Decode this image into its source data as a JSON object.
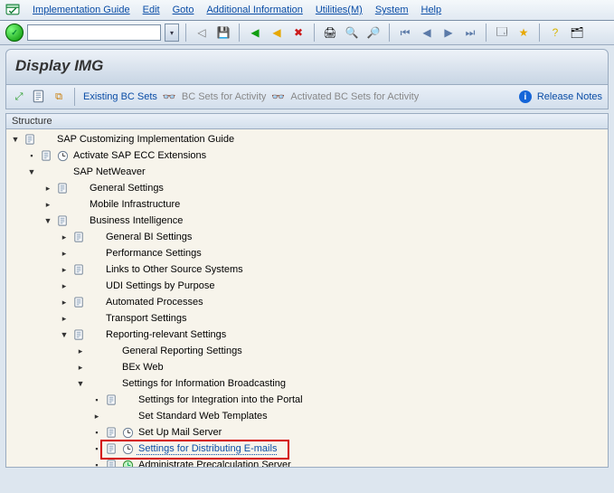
{
  "menu": {
    "items": [
      {
        "label": "Implementation Guide",
        "underline": 0
      },
      {
        "label": "Edit",
        "underline": 0
      },
      {
        "label": "Goto",
        "underline": 0
      },
      {
        "label": "Additional Information",
        "underline": 0
      },
      {
        "label": "Utilities(M)",
        "underline": 10
      },
      {
        "label": "System",
        "underline": 0
      },
      {
        "label": "Help",
        "underline": 0
      }
    ]
  },
  "cmdbar": {
    "value": "",
    "placeholder": ""
  },
  "title": "Display IMG",
  "apptb": {
    "existing": "Existing BC Sets",
    "bc_activity": "BC Sets for Activity",
    "bc_activated": "Activated BC Sets for Activity",
    "release_notes": "Release Notes"
  },
  "structure_header": "Structure",
  "tree_labels": {
    "root": "SAP Customizing Implementation Guide",
    "l1a": "Activate SAP ECC Extensions",
    "l1b": "SAP NetWeaver",
    "l2a": "General Settings",
    "l2b": "Mobile Infrastructure",
    "l2c": "Business Intelligence",
    "l3a": "General BI Settings",
    "l3b": "Performance Settings",
    "l3c": "Links to Other Source Systems",
    "l3d": "UDI Settings by Purpose",
    "l3e": "Automated Processes",
    "l3f": "Transport Settings",
    "l3g": "Reporting-relevant Settings",
    "l4a": "General Reporting Settings",
    "l4b": "BEx Web",
    "l4c": "Settings for Information Broadcasting",
    "l5a": "Settings for Integration into the Portal",
    "l5b": "Set Standard Web Templates",
    "l5c": "Set Up Mail Server",
    "l5d": "Settings for Distributing E-mails",
    "l5e": "Administrate Precalculation Server"
  }
}
